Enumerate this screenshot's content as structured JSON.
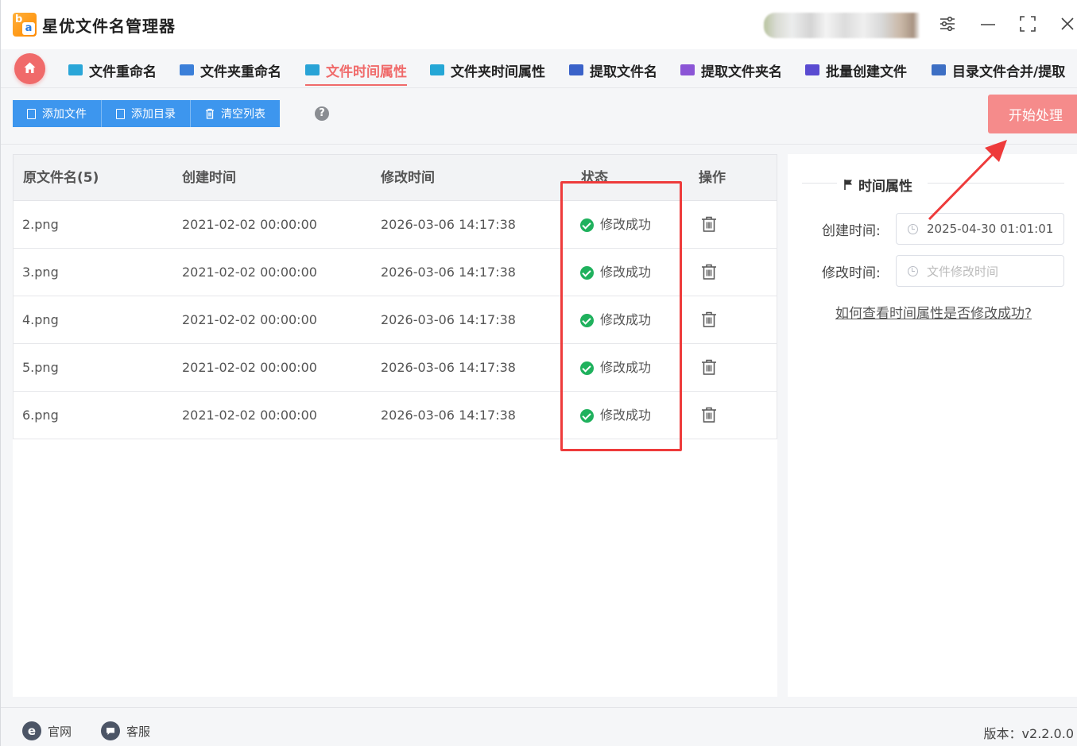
{
  "app": {
    "title": "星优文件名管理器",
    "logo_letters": [
      "b",
      "a"
    ]
  },
  "window_controls": [
    "settings-icon",
    "minimize-icon",
    "maximize-icon",
    "close-icon"
  ],
  "tabs": [
    {
      "label": "文件重命名",
      "active": false,
      "icon": "file-rename-icon",
      "color": "#2aa6d8"
    },
    {
      "label": "文件夹重命名",
      "active": false,
      "icon": "folder-rename-icon",
      "color": "#3b7fd9"
    },
    {
      "label": "文件时间属性",
      "active": true,
      "icon": "file-time-icon",
      "color": "#29a3d6"
    },
    {
      "label": "文件夹时间属性",
      "active": false,
      "icon": "folder-time-icon",
      "color": "#25a7d6"
    },
    {
      "label": "提取文件名",
      "active": false,
      "icon": "extract-filename-icon",
      "color": "#3a62c9"
    },
    {
      "label": "提取文件夹名",
      "active": false,
      "icon": "extract-foldername-icon",
      "color": "#8b55d6"
    },
    {
      "label": "批量创建文件",
      "active": false,
      "icon": "batch-create-icon",
      "color": "#5a4bd1"
    },
    {
      "label": "目录文件合并/提取",
      "active": false,
      "icon": "merge-extract-icon",
      "color": "#3d6fc4"
    }
  ],
  "toolbar": {
    "add_file": "添加文件",
    "add_dir": "添加目录",
    "clear_list": "清空列表",
    "help": "?",
    "start": "开始处理"
  },
  "table": {
    "headers": [
      "原文件名(5)",
      "创建时间",
      "修改时间",
      "状态",
      "操作"
    ],
    "rows": [
      {
        "name": "2.png",
        "created": "2021-02-02 00:00:00",
        "modified": "2026-03-06 14:17:38",
        "status": "修改成功"
      },
      {
        "name": "3.png",
        "created": "2021-02-02 00:00:00",
        "modified": "2026-03-06 14:17:38",
        "status": "修改成功"
      },
      {
        "name": "4.png",
        "created": "2021-02-02 00:00:00",
        "modified": "2026-03-06 14:17:38",
        "status": "修改成功"
      },
      {
        "name": "5.png",
        "created": "2021-02-02 00:00:00",
        "modified": "2026-03-06 14:17:38",
        "status": "修改成功"
      },
      {
        "name": "6.png",
        "created": "2021-02-02 00:00:00",
        "modified": "2026-03-06 14:17:38",
        "status": "修改成功"
      }
    ]
  },
  "panel": {
    "title": "时间属性",
    "created_label": "创建时间:",
    "created_value": "2025-04-30 01:01:01",
    "modified_label": "修改时间:",
    "modified_placeholder": "文件修改时间",
    "help_link": "如何查看时间属性是否修改成功?"
  },
  "footer": {
    "website": "官网",
    "support": "客服",
    "version": "版本：v2.2.0.0"
  },
  "colors": {
    "accent": "#f06a6a",
    "primary_button": "#3d96ee",
    "start_button": "#f58b8b",
    "success": "#1fb15d",
    "annotation": "#ee3b3b"
  }
}
